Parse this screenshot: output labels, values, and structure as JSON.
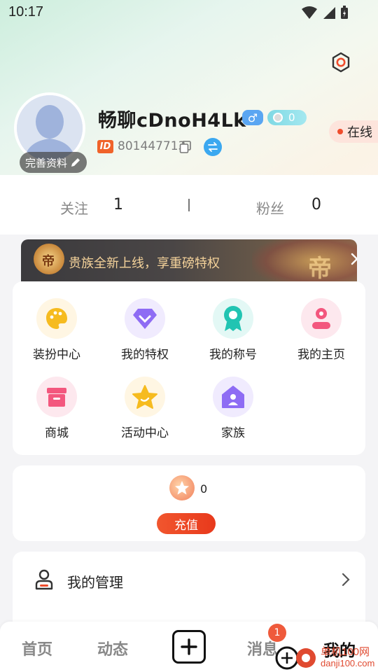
{
  "status_bar": {
    "time": "10:17"
  },
  "profile": {
    "username": "畅聊cDnoH4Lk",
    "gender_symbol": "♂",
    "level_value": "0",
    "online_label": "在线",
    "id_tag": "ID",
    "id_number": "801447713",
    "edit_profile_label": "完善资料"
  },
  "stats": {
    "following_label": "关注",
    "following_count": "1",
    "divider": "|",
    "fans_label": "粉丝",
    "fans_count": "0"
  },
  "noble_banner": {
    "text": "贵族全新上线，享重磅特权",
    "crest_char": "帝",
    "deco_char": "帝"
  },
  "menu": {
    "items": [
      {
        "label": "装扮中心",
        "icon": "palette-icon",
        "color": "#f6bb1f"
      },
      {
        "label": "我的特权",
        "icon": "diamond-icon",
        "color": "#8e6cf4"
      },
      {
        "label": "我的称号",
        "icon": "badge-icon",
        "color": "#21c4b2"
      },
      {
        "label": "我的主页",
        "icon": "user-icon",
        "color": "#f3577e"
      },
      {
        "label": "商城",
        "icon": "shop-icon",
        "color": "#f3577e"
      },
      {
        "label": "活动中心",
        "icon": "star-icon",
        "color": "#f6bb1f"
      },
      {
        "label": "家族",
        "icon": "home-icon",
        "color": "#8e6cf4"
      }
    ]
  },
  "wallet": {
    "coin_count": "0",
    "recharge_label": "充值"
  },
  "manage": {
    "label": "我的管理"
  },
  "tabbar": {
    "home": "首页",
    "feed": "动态",
    "messages": "消息",
    "messages_badge": "1",
    "mine": "我的"
  },
  "watermark": {
    "text": "单机100网",
    "url": "danji100.com"
  },
  "colors": {
    "accent": "#ef4d2d",
    "noble_gold": "#f4d29a"
  }
}
